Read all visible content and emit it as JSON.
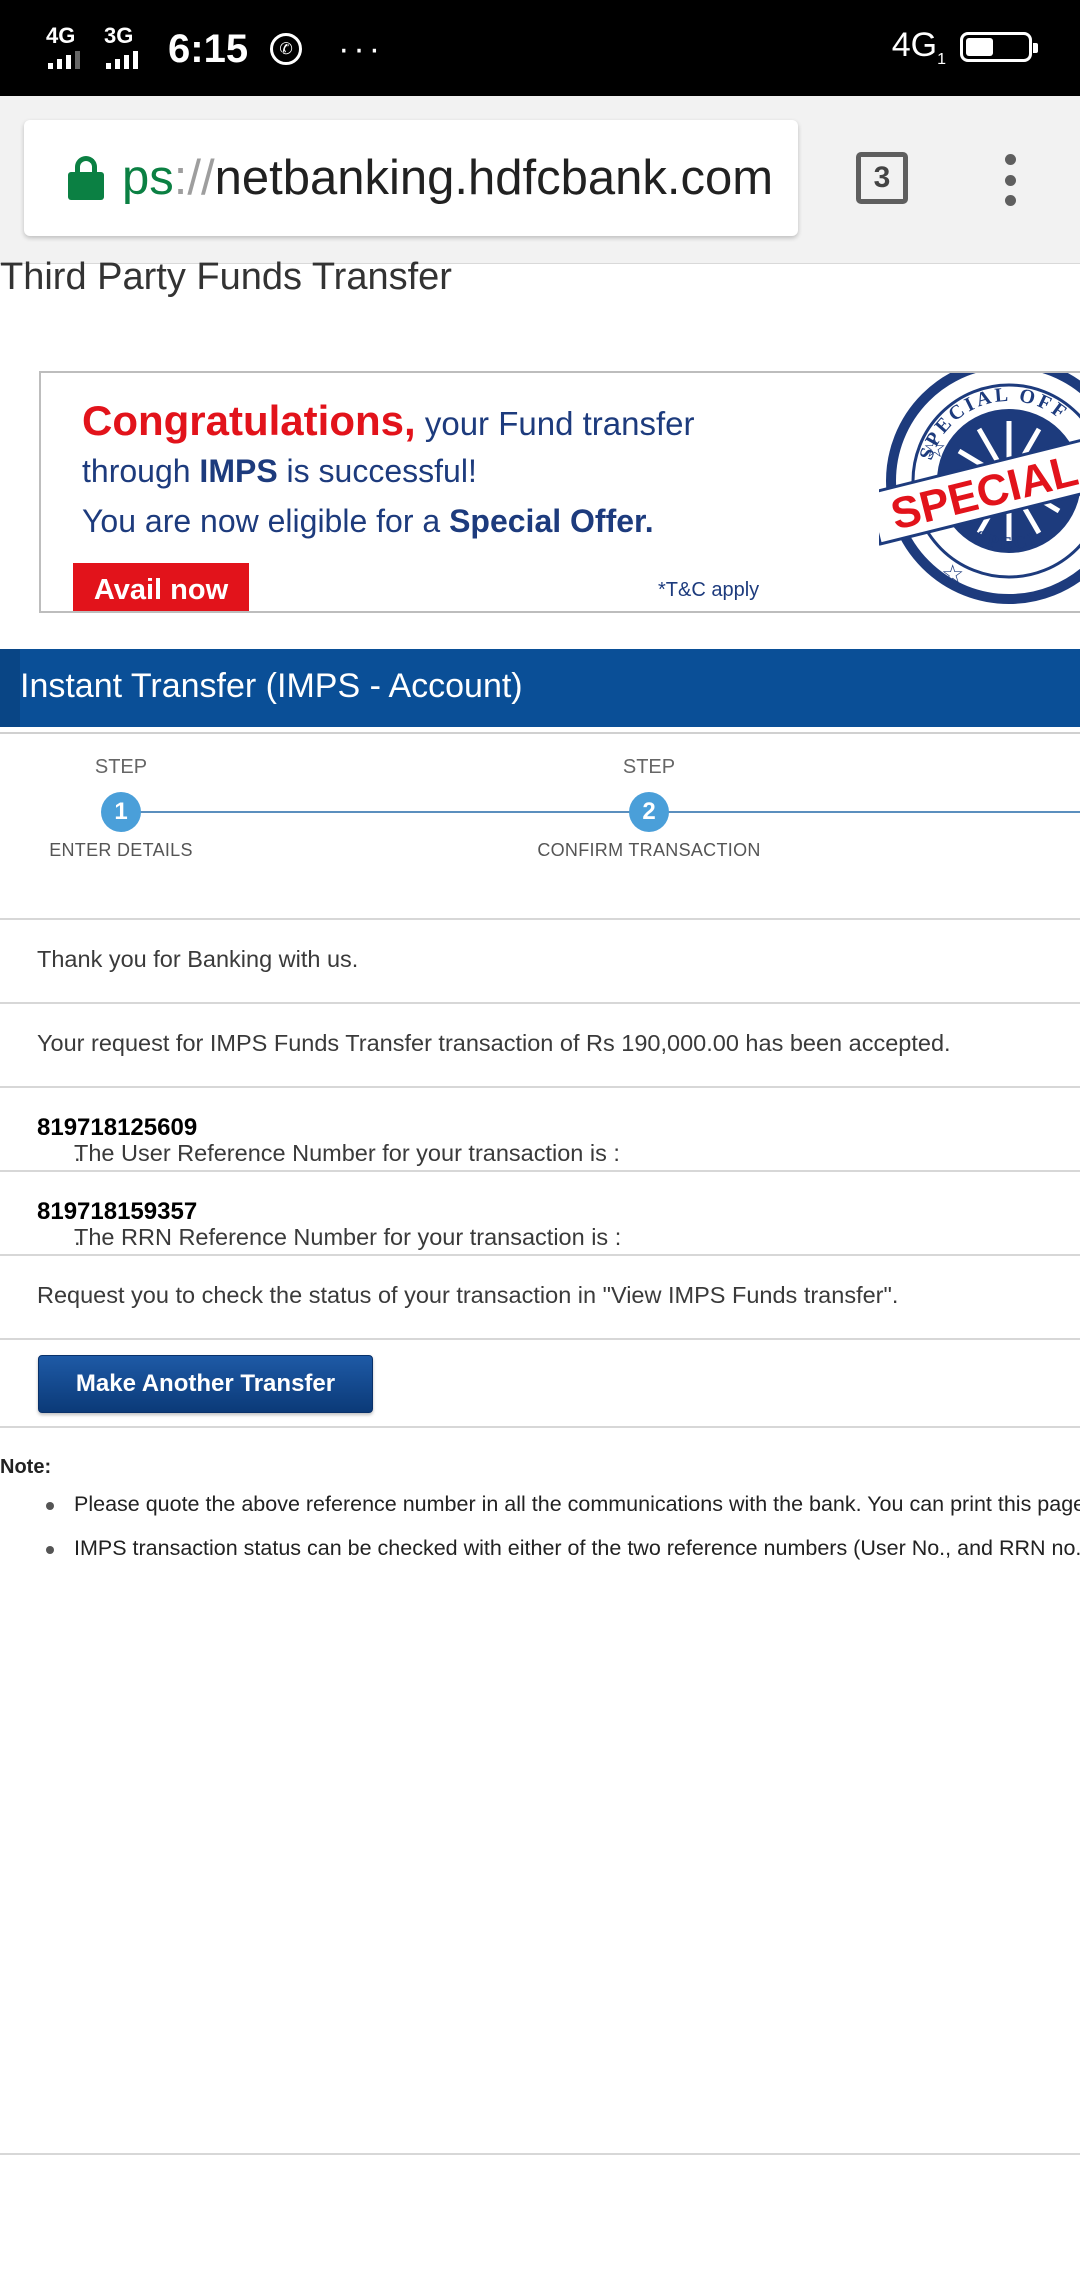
{
  "status_bar": {
    "net1": "4G",
    "net2": "3G",
    "time": "6:15",
    "more": "···",
    "net_right": "4G",
    "net_right_sub": "1",
    "battery_level": 0.45
  },
  "browser": {
    "url_scheme": "ps",
    "url_sep": "://",
    "url_host": "netbanking.hdfcbank.com",
    "tab_count": "3"
  },
  "page": {
    "title": "Third Party Funds Transfer"
  },
  "banner": {
    "congrats": "Congratulations,",
    "line1_rest": " your Fund transfer",
    "line2_pre": "through ",
    "line2_bold": "IMPS",
    "line2_post": " is successful!",
    "line3_pre": "You are now eligible for a ",
    "line3_bold": "Special Offer.",
    "avail_label": "Avail now",
    "tc": "*T&C apply",
    "stamp_top": "SPECIAL OFF",
    "stamp_mid": "SPECIAL",
    "stamp_bottom": "SPECI",
    "colors": {
      "red": "#e2131b",
      "navy": "#1d3b7d"
    }
  },
  "section": {
    "title": "Instant Transfer (IMPS - Account)"
  },
  "steps": [
    {
      "label": "STEP",
      "number": "1",
      "caption": "ENTER DETAILS"
    },
    {
      "label": "STEP",
      "number": "2",
      "caption": "CONFIRM TRANSACTION"
    }
  ],
  "messages": {
    "thanks": "Thank you for Banking with us.",
    "accepted": "Your request for IMPS Funds Transfer transaction of Rs 190,000.00 has been accepted.",
    "user_ref_label": "The User Reference Number for your transaction is : ",
    "user_ref": "819718125609",
    "rrn_label": "The RRN Reference Number for your transaction is : ",
    "rrn": "819718159357",
    "period": ".",
    "check_status": "Request you to check the status of your transaction in \"View IMPS Funds transfer\"."
  },
  "actions": {
    "make_another": "Make Another Transfer"
  },
  "note": {
    "label": "Note:",
    "items": [
      "Please quote the above reference number in all the communications with the bank. You can print this page",
      "IMPS transaction status can be checked with either of the two reference numbers (User No., and RRN no.)."
    ]
  },
  "colors": {
    "header_blue": "#0a4f97",
    "step_blue": "#4a9fd9",
    "secure_green": "#0b8043"
  }
}
